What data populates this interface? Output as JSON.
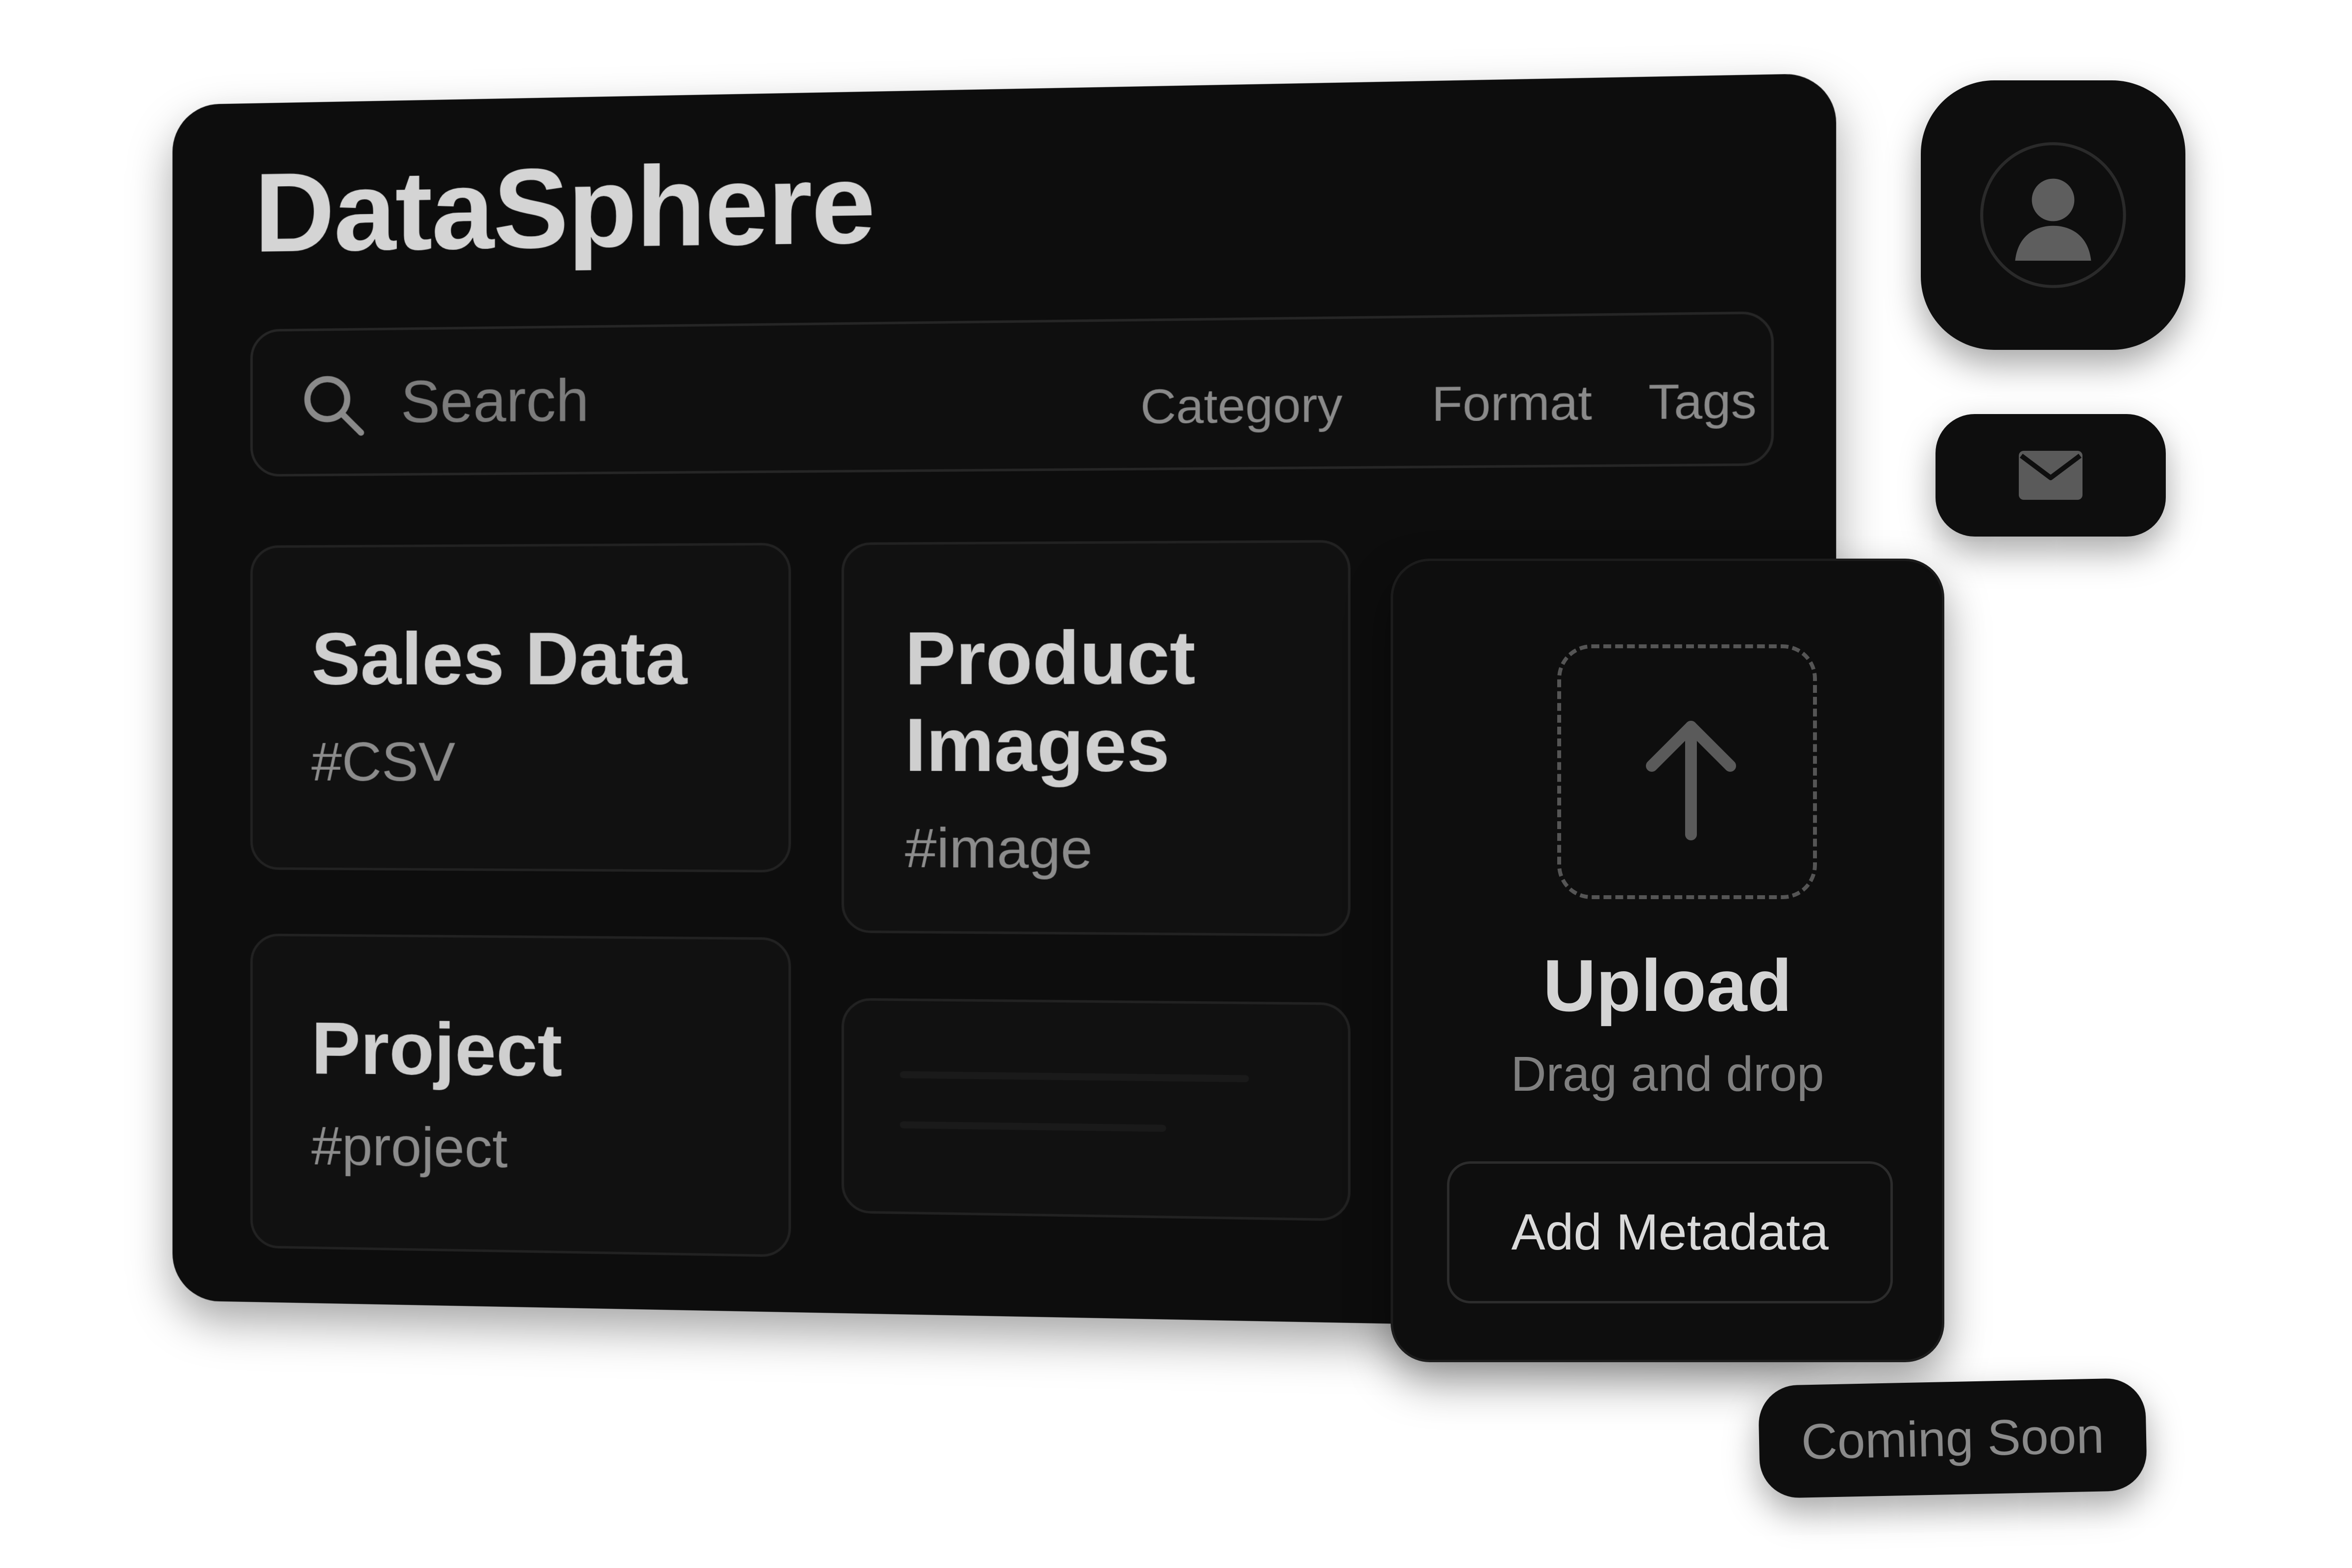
{
  "app": {
    "title": "DataSphere"
  },
  "search": {
    "placeholder": "Search",
    "filters": {
      "category": "Category",
      "format": "Format",
      "tags": "Tags"
    }
  },
  "datasets": [
    {
      "title": "Sales Data",
      "tag": "#CSV"
    },
    {
      "title": "Product Images",
      "tag": "#image"
    },
    {
      "title": "Project",
      "tag": "#project"
    }
  ],
  "upload": {
    "title": "Upload",
    "subtitle": "Drag and drop",
    "metadata_button": "Add Metadata"
  },
  "badges": {
    "coming_soon": "Coming Soon"
  },
  "icons": {
    "search": "search-icon",
    "upload": "upload-arrow-icon",
    "avatar": "user-avatar-icon",
    "mail": "mail-icon"
  },
  "colors": {
    "background": "#ffffff",
    "panel": "#0d0d0d",
    "text_primary": "#d4d4d4",
    "text_muted": "#8a8a8a",
    "border": "#262626"
  }
}
